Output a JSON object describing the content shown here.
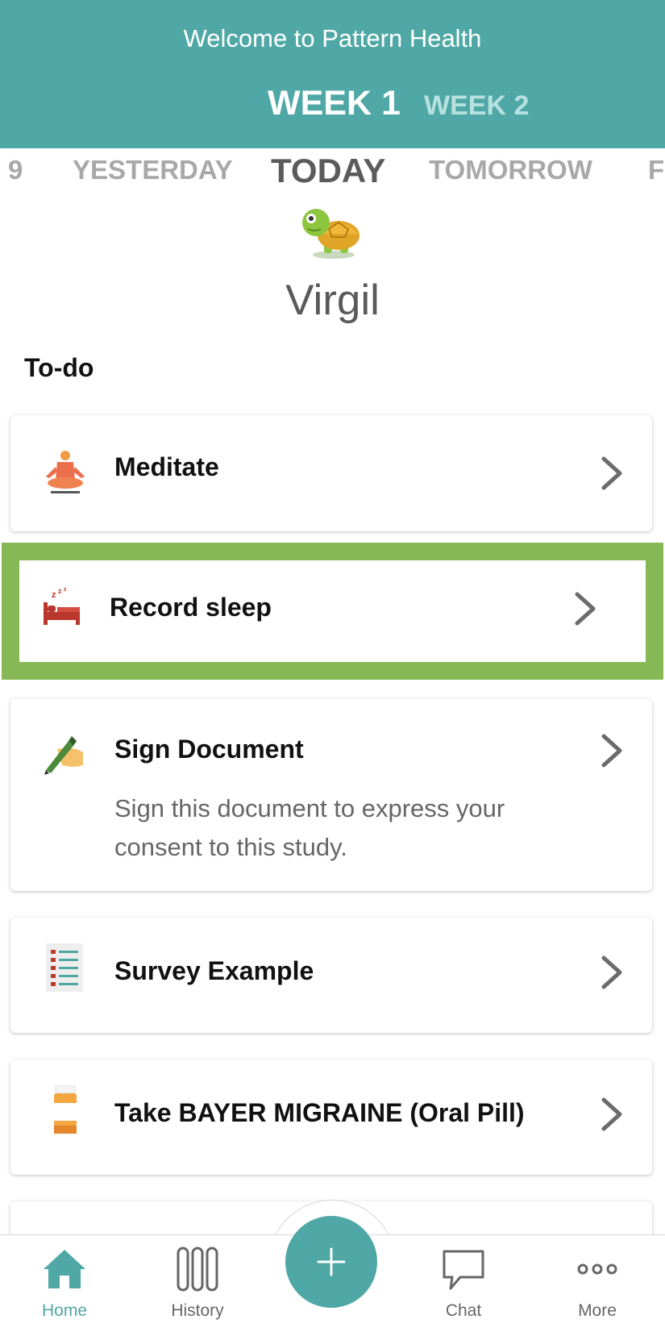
{
  "header": {
    "title": "Welcome to Pattern Health",
    "weeks": [
      "WEEK 1",
      "WEEK 2"
    ]
  },
  "days": [
    "9",
    "YESTERDAY",
    "TODAY",
    "TOMORROW",
    "F"
  ],
  "profile": {
    "name": "Virgil",
    "avatar": "turtle-avatar"
  },
  "todo": {
    "label": "To-do",
    "items": [
      {
        "title": "Meditate",
        "icon": "meditate-icon"
      },
      {
        "title": "Record sleep",
        "icon": "bed-icon"
      },
      {
        "title": "Sign Document",
        "description": "Sign this document to express your consent to this study.",
        "icon": "signature-icon"
      },
      {
        "title": "Survey Example",
        "icon": "survey-icon"
      },
      {
        "title": "Take BAYER MIGRAINE (Oral Pill)",
        "icon": "pill-bottle-icon"
      }
    ]
  },
  "nav": [
    {
      "label": "Home",
      "icon": "home-icon",
      "active": true
    },
    {
      "label": "History",
      "icon": "history-icon"
    },
    {
      "label": "Chat",
      "icon": "chat-icon"
    },
    {
      "label": "More",
      "icon": "more-icon"
    }
  ],
  "colors": {
    "brand": "#4fa8a5",
    "highlight": "#86b955",
    "week_inactive": "#b7e1de"
  }
}
